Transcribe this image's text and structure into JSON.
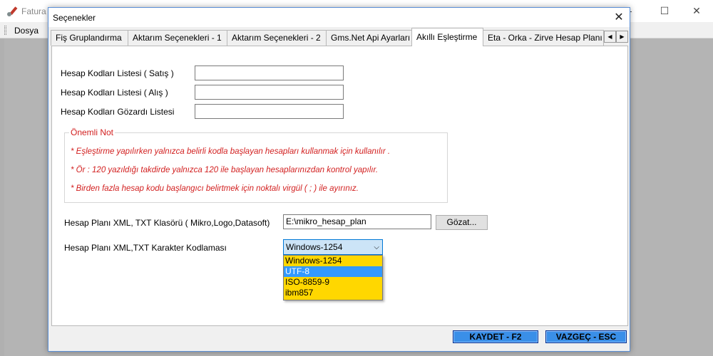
{
  "background_window": {
    "title": "Fatura",
    "menu": [
      "Dosya"
    ],
    "controls": {
      "minimize": "—",
      "maximize": "☐",
      "close": "✕"
    }
  },
  "dialog": {
    "title": "Seçenekler",
    "close_glyph": "✕",
    "tabs": [
      {
        "label": "Fiş Gruplandırma",
        "active": false
      },
      {
        "label": "Aktarım Seçenekleri - 1",
        "active": false
      },
      {
        "label": "Aktarım Seçenekleri - 2",
        "active": false
      },
      {
        "label": "Gms.Net Api Ayarları",
        "active": false
      },
      {
        "label": "Akıllı Eşleştirme",
        "active": true
      },
      {
        "label": "Eta - Orka - Zirve Hesap Planı",
        "active": false
      }
    ],
    "tab_scroll": {
      "left": "◀",
      "right": "▶"
    },
    "fields": {
      "satis": {
        "label": "Hesap Kodları Listesi ( Satış )",
        "value": ""
      },
      "alis": {
        "label": "Hesap Kodları Listesi ( Alış )",
        "value": ""
      },
      "gozardi": {
        "label": "Hesap Kodları Gözardı Listesi",
        "value": ""
      }
    },
    "note": {
      "title": "Önemli Not",
      "lines": [
        "* Eşleştirme yapılırken yalnızca belirli kodla başlayan hesapları kullanmak için kullanılır .",
        "* Ör : 120 yazıldığı takdirde yalnızca 120 ile başlayan hesaplarınızdan kontrol yapılır.",
        "* Birden fazla hesap kodu başlangıcı belirtmek için noktalı virgül ( ; ) ile ayırınız."
      ]
    },
    "folder": {
      "label": "Hesap Planı XML, TXT Klasörü ( Mikro,Logo,Datasoft)",
      "value": "E:\\mikro_hesap_plan",
      "browse_label": "Gözat..."
    },
    "encoding": {
      "label": "Hesap Planı XML,TXT Karakter Kodlaması",
      "selected": "Windows-1254",
      "chevron": "⌵",
      "options": [
        "Windows-1254",
        "UTF-8",
        "ISO-8859-9",
        "ibm857"
      ],
      "highlighted": "UTF-8"
    },
    "buttons": {
      "save": "KAYDET - F2",
      "cancel": "VAZGEÇ - ESC"
    }
  },
  "colors": {
    "note_text": "#d21f1f",
    "dropdown_bg": "#ffd700",
    "dropdown_highlight": "#3399ff",
    "footer_button": "#3a8fe8"
  }
}
